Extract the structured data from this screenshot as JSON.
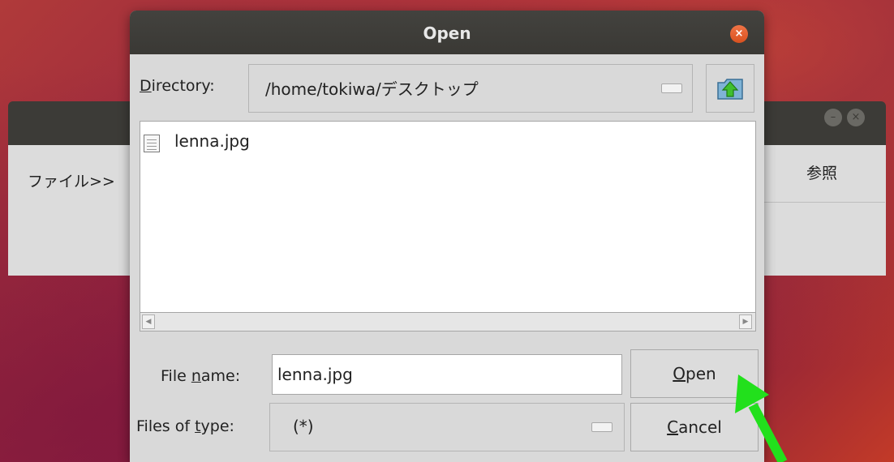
{
  "background_window": {
    "label": "ファイル>>",
    "browse_button": "参照",
    "minimize_glyph": "–",
    "close_glyph": "×"
  },
  "dialog": {
    "title": "Open",
    "close_glyph": "×",
    "directory": {
      "label_mnemonic": "D",
      "label_rest": "irectory:",
      "value": "/home/tokiwa/デスクトップ"
    },
    "files": [
      {
        "name": "lenna.jpg",
        "icon": "document-icon"
      }
    ],
    "file_name": {
      "label_pre": "File ",
      "label_mnemonic": "n",
      "label_post": "ame:",
      "value": "lenna.jpg"
    },
    "files_of_type": {
      "label_pre": "Files of ",
      "label_mnemonic": "t",
      "label_post": "ype:",
      "value": "(*)"
    },
    "open_button": {
      "mnemonic": "O",
      "rest": "pen"
    },
    "cancel_button": {
      "mnemonic": "C",
      "rest": "ancel"
    }
  },
  "colors": {
    "titlebar": "#3c3b37",
    "dialog_bg": "#d9d9d9",
    "close_button": "#e95420",
    "annotation_arrow": "#22e01c"
  }
}
